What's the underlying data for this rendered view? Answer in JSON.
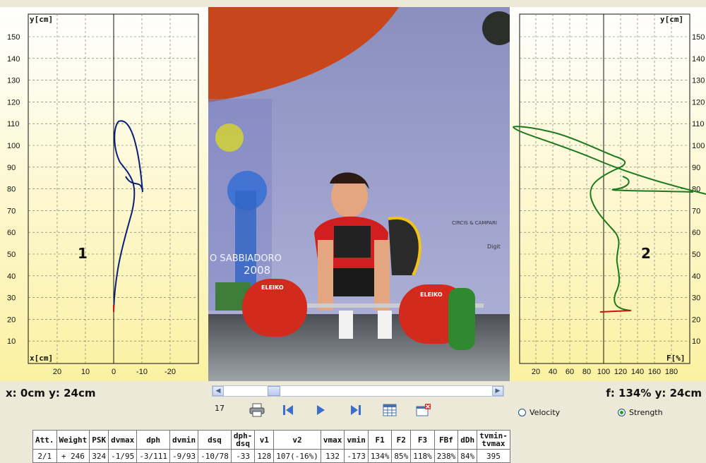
{
  "left_plot": {
    "y_axis_label": "y[cm]",
    "x_axis_label": "x[cm]",
    "marker": "1",
    "y_ticks": [
      "150",
      "140",
      "130",
      "120",
      "110",
      "100",
      "90",
      "80",
      "70",
      "60",
      "50",
      "40",
      "30",
      "20",
      "10"
    ],
    "x_ticks": [
      "20",
      "10",
      "0",
      "-10",
      "-20"
    ],
    "trace_color": "#0a1f7a",
    "start_color": "#cc1111"
  },
  "right_plot": {
    "y_axis_label": "y[cm]",
    "x_axis_label": "F[%]",
    "marker": "2",
    "y_ticks": [
      "150",
      "140",
      "130",
      "120",
      "110",
      "100",
      "90",
      "80",
      "70",
      "60",
      "50",
      "40",
      "30",
      "20",
      "10"
    ],
    "x_ticks": [
      "20",
      "40",
      "60",
      "80",
      "100",
      "120",
      "140",
      "160",
      "180"
    ],
    "trace_color": "#1a7a1a",
    "start_color": "#cc1111"
  },
  "readouts": {
    "left": "x: 0cm y: 24cm",
    "right": "f: 134% y: 24cm"
  },
  "controls": {
    "frame_number": "17"
  },
  "radios": {
    "velocity_label": "Velocity",
    "strength_label": "Strength",
    "selected": "Strength"
  },
  "video": {
    "banner_text": "O SABBIADORO",
    "banner_year": "2008",
    "plate_brand": "ELEIKO",
    "sponsor": "CIRCIS & CAMPARI",
    "board_text": "Digit"
  },
  "table": {
    "headers": [
      "Att.",
      "Weight",
      "PSK",
      "dvmax",
      "dph",
      "dvmin",
      "dsq",
      "dph-\ndsq",
      "v1",
      "v2",
      "vmax",
      "vmin",
      "F1",
      "F2",
      "F3",
      "FBf",
      "dDh",
      "tvmin-\ntvmax"
    ],
    "rows": [
      [
        "2/1",
        "+ 246",
        "324",
        "-1/95",
        "-3/111",
        "-9/93",
        "-10/78",
        "-33",
        "128",
        "107(-16%)",
        "132",
        "-173",
        "134%",
        "85%",
        "118%",
        "238%",
        "84%",
        "395"
      ]
    ]
  }
}
